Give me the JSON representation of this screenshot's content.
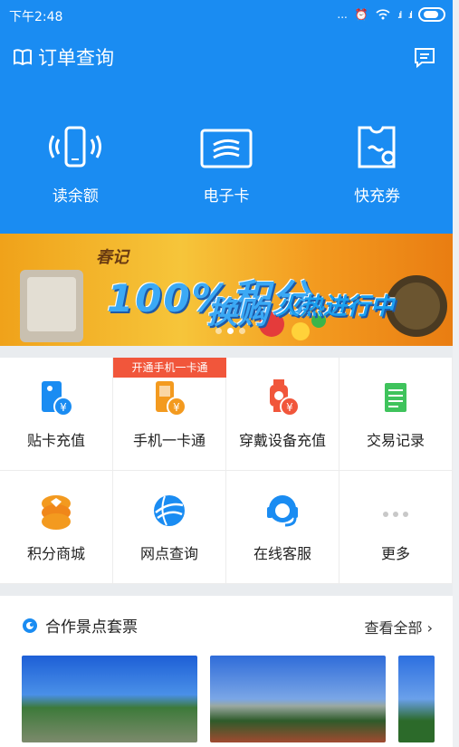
{
  "status": {
    "time": "下午2:48",
    "dots": "...",
    "signal": ".ıl"
  },
  "header": {
    "title": "订单查询"
  },
  "quick_actions": [
    {
      "label": "读余额",
      "icon": "nfc-phone-icon"
    },
    {
      "label": "电子卡",
      "icon": "e-card-icon"
    },
    {
      "label": "快充券",
      "icon": "voucher-icon"
    }
  ],
  "banner": {
    "brand": "春记",
    "headline": "100%积分",
    "headline2": "换购",
    "subline": "火热进行中",
    "active_dot": 1
  },
  "grid": {
    "promo_tag": "开通手机一卡通",
    "items": [
      {
        "label": "贴卡充值",
        "icon": "card-recharge-icon",
        "color": "#1a8cf2"
      },
      {
        "label": "手机一卡通",
        "icon": "phone-card-icon",
        "color": "#f39a1f"
      },
      {
        "label": "穿戴设备充值",
        "icon": "wearable-icon",
        "color": "#f1563b"
      },
      {
        "label": "交易记录",
        "icon": "record-icon",
        "color": "#3fc35c"
      },
      {
        "label": "积分商城",
        "icon": "points-mall-icon",
        "color": "#f39a1f"
      },
      {
        "label": "网点查询",
        "icon": "globe-icon",
        "color": "#1a8cf2"
      },
      {
        "label": "在线客服",
        "icon": "customer-service-icon",
        "color": "#1a8cf2"
      },
      {
        "label": "更多",
        "icon": "more-dots-icon",
        "color": "#c8c8c8"
      }
    ]
  },
  "section": {
    "title": "合作景点套票",
    "more": "查看全部 ›"
  },
  "colors": {
    "primary": "#1a8cf2",
    "tag": "#f1563b"
  }
}
